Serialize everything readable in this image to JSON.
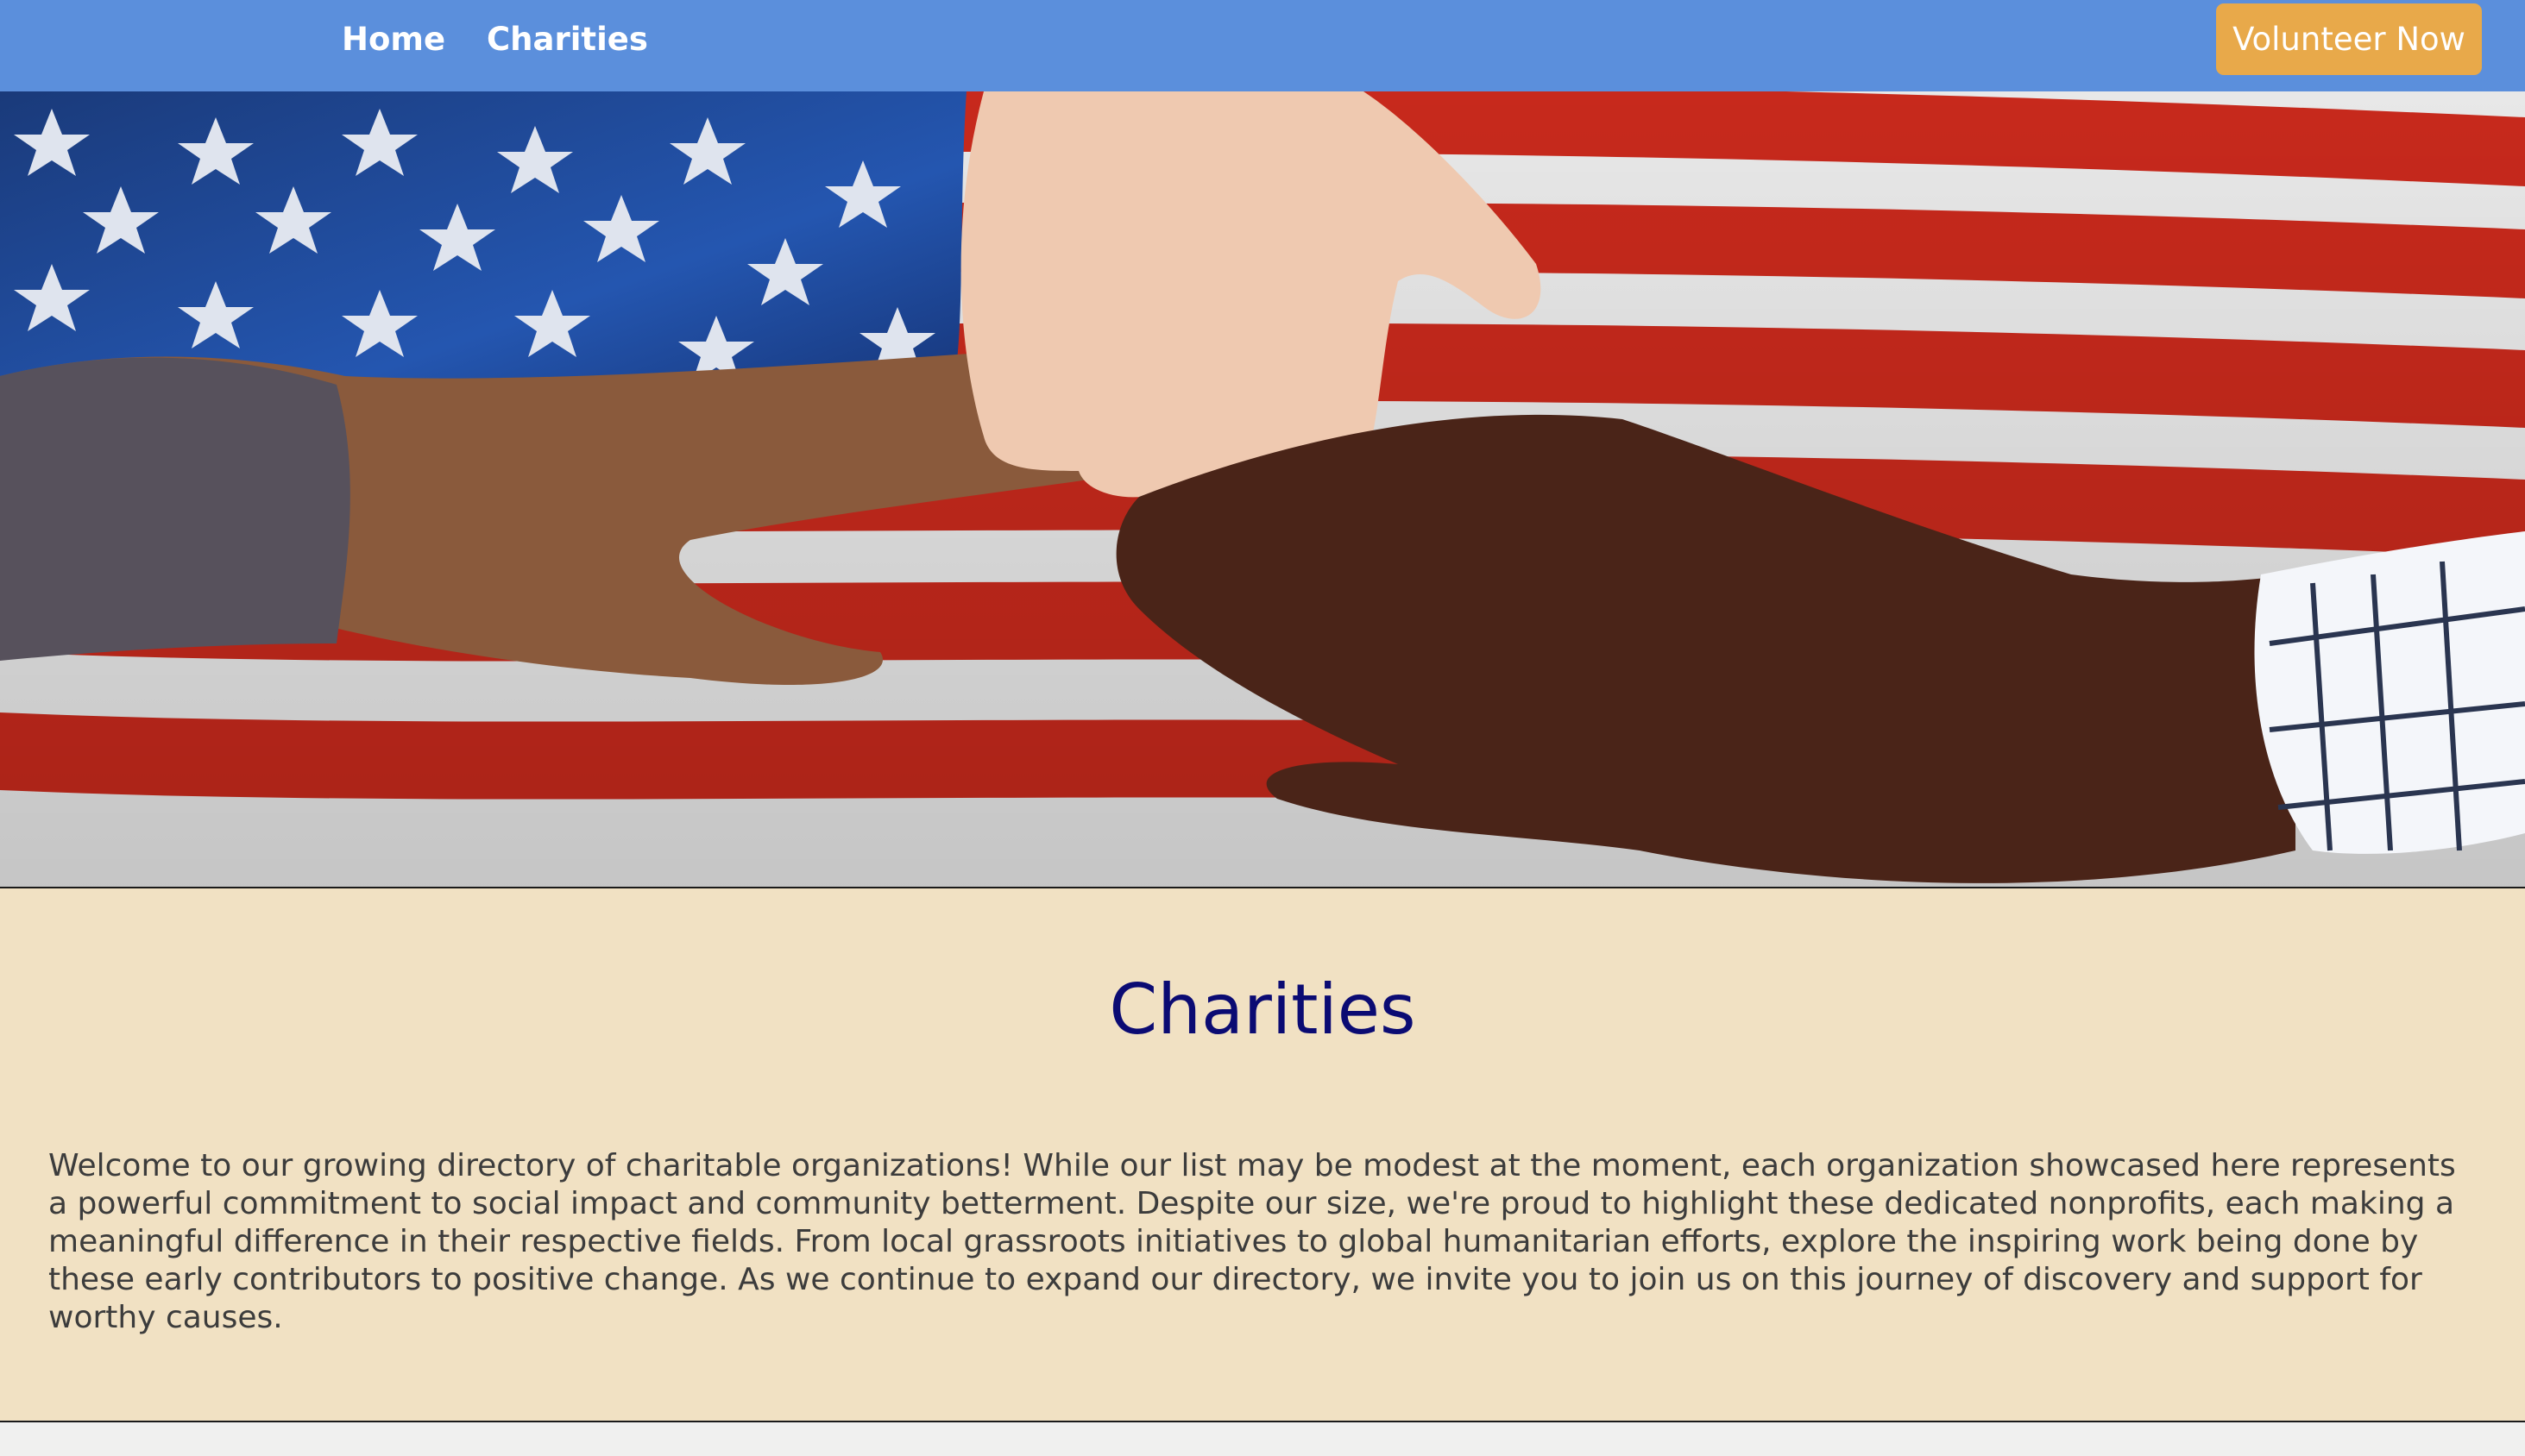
{
  "nav": {
    "home_label": "Home",
    "charities_label": "Charities",
    "volunteer_label": "Volunteer Now",
    "bar_color": "#5b8fdc",
    "button_color": "#e8a94a"
  },
  "hero": {
    "image": "hands-on-american-flag"
  },
  "main": {
    "title": "Charities",
    "intro": "Welcome to our growing directory of charitable organizations! While our list may be modest at the moment, each organization showcased here represents a powerful commitment to social impact and community betterment. Despite our size, we're proud to highlight these dedicated nonprofits, each making a meaningful difference in their respective fields. From local grassroots initiatives to global humanitarian efforts, explore the inspiring work being done by these early contributors to positive change. As we continue to expand our directory, we invite you to join us on this journey of discovery and support for worthy causes.",
    "background_color": "#f1e1c3",
    "title_color": "#0b0b73"
  }
}
